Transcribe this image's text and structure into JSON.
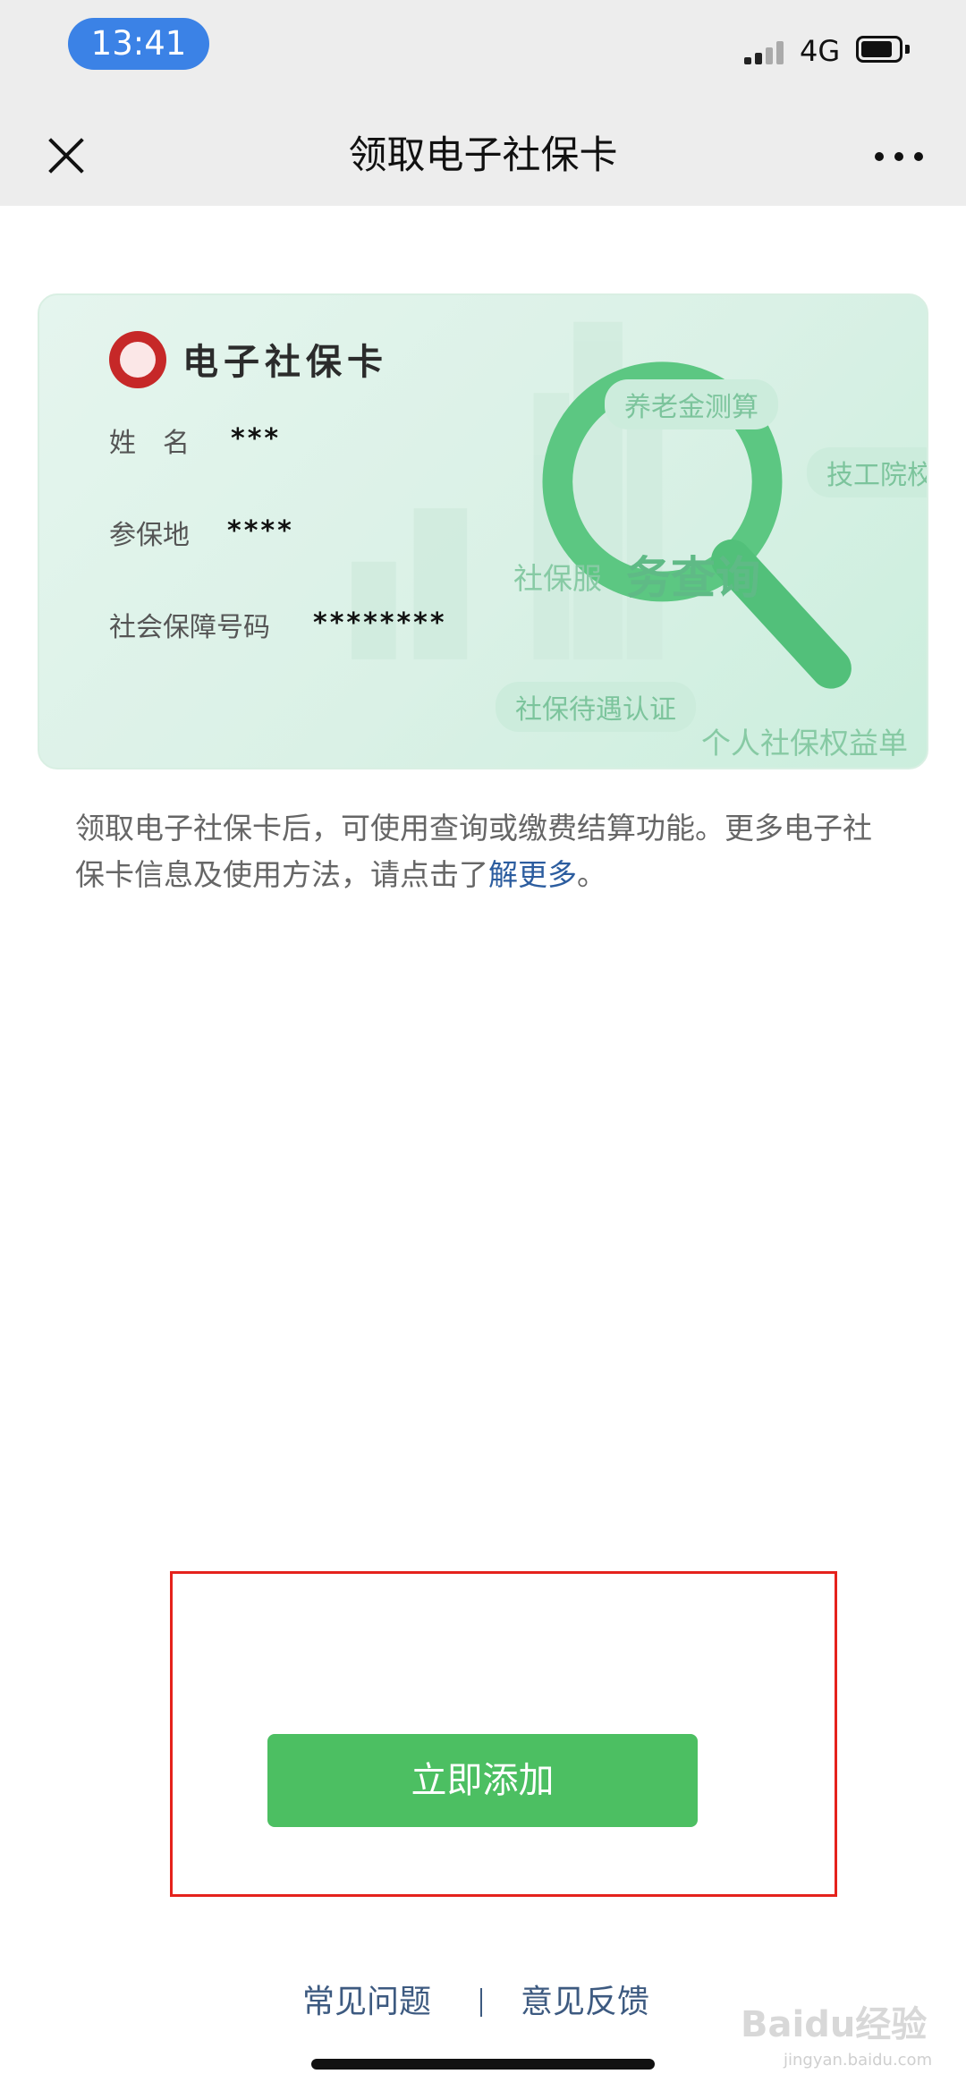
{
  "status_bar": {
    "time": "13:41",
    "network": "4G"
  },
  "nav": {
    "title": "领取电子社保卡"
  },
  "card": {
    "title": "电子社保卡",
    "rows": [
      {
        "label": "姓　名",
        "value": "***"
      },
      {
        "label": "参保地",
        "value": "****"
      },
      {
        "label": "社会保障号码",
        "value": "********"
      }
    ],
    "tags": {
      "pension": "养老金测算",
      "technical": "技工院校",
      "service_prefix": "社保服",
      "service_main": "务查询",
      "benefit_cert": "社保待遇认证",
      "rights": "个人社保权益单"
    }
  },
  "description": {
    "text": "领取电子社保卡后，可使用查询或缴费结算功能。更多电子社保卡信息及使用方法，请点击了",
    "link": "解更多",
    "end": "。"
  },
  "primary_button": {
    "label": "立即添加",
    "color": "#4cbf62"
  },
  "footer": {
    "faq": "常见问题",
    "feedback": "意见反馈"
  },
  "watermark": {
    "brand": "Baidu经验",
    "url": "jingyan.baidu.com"
  }
}
